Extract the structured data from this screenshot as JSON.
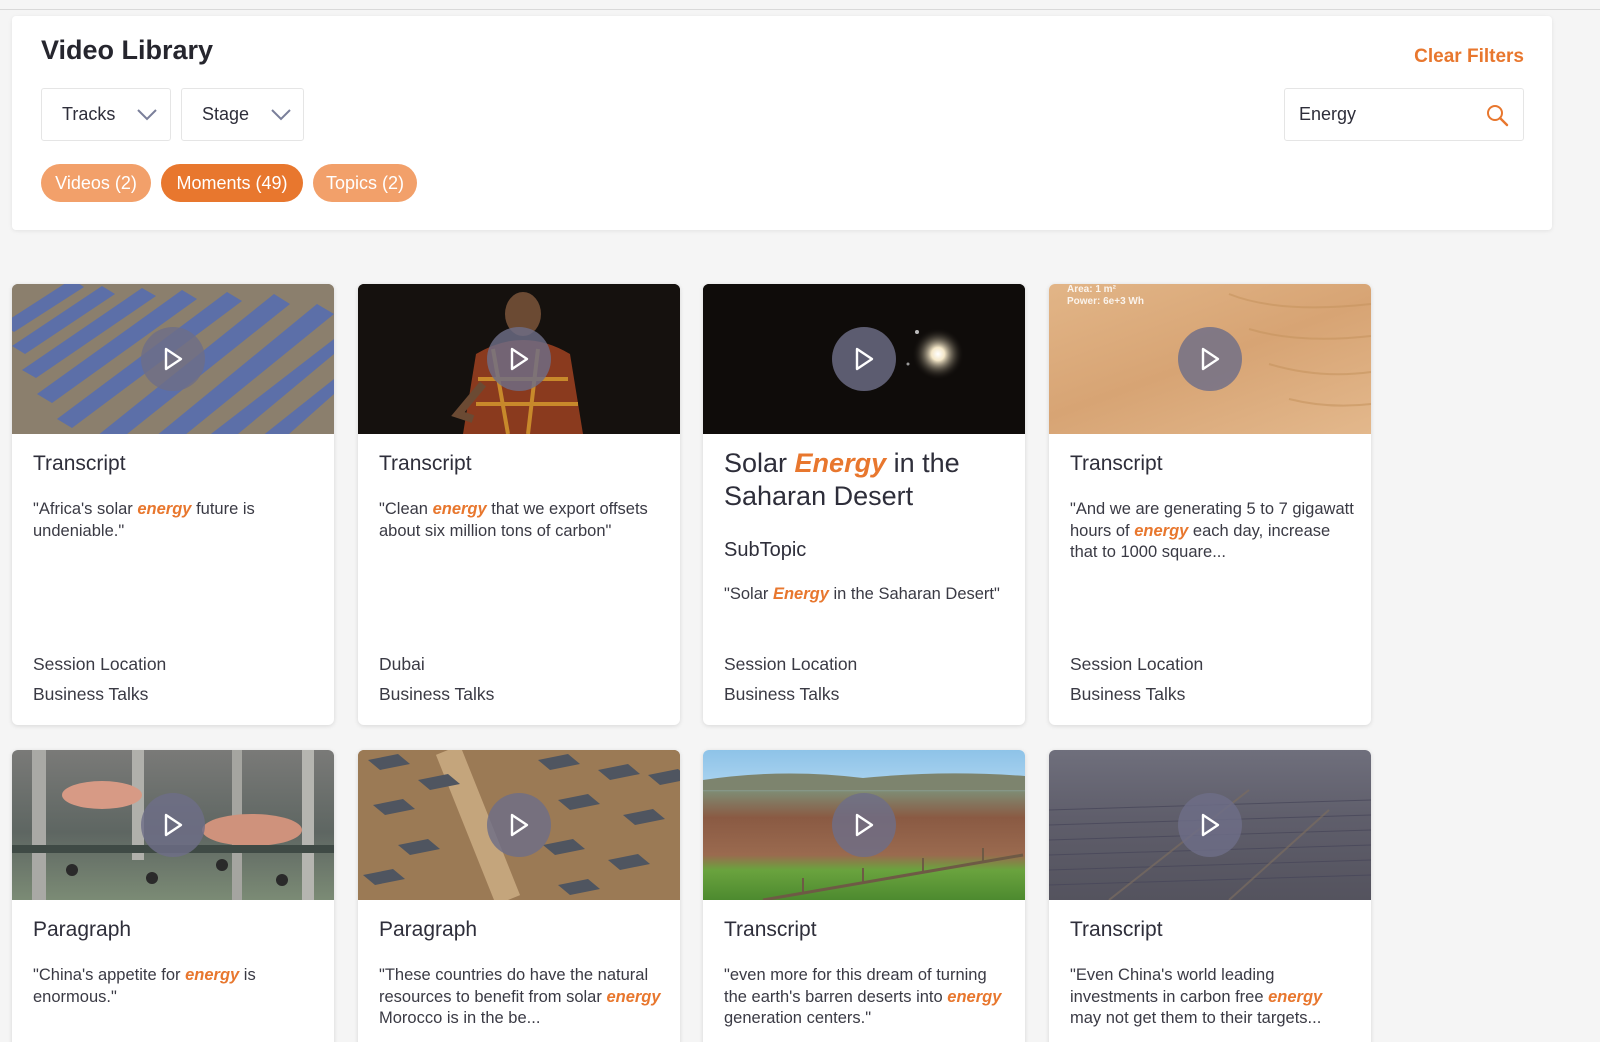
{
  "header": {
    "title": "Video Library",
    "clear_filters": "Clear Filters"
  },
  "filters": {
    "tracks_label": "Tracks",
    "stage_label": "Stage",
    "search_value": "Energy"
  },
  "pills": {
    "videos": "Videos (2)",
    "moments": "Moments (49)",
    "topics": "Topics (2)"
  },
  "cards": [
    {
      "type": "Transcript",
      "quote_before": "\"Africa's solar ",
      "quote_highlight": "energy",
      "quote_after": " future is undeniable.\"",
      "meta1": "Session Location",
      "meta2": "Business Talks"
    },
    {
      "type": "Transcript",
      "quote_before": "\"Clean ",
      "quote_highlight": "energy",
      "quote_after": " that we export offsets about six million tons of carbon\"",
      "meta1": "Dubai",
      "meta2": "Business Talks"
    },
    {
      "title_before": "Solar ",
      "title_highlight": "Energy",
      "title_after": " in the Saharan Desert",
      "subtopic": "SubTopic",
      "quote_before": "\"Solar ",
      "quote_highlight": "Energy",
      "quote_after": " in the Saharan Desert\"",
      "meta1": "Session Location",
      "meta2": "Business Talks"
    },
    {
      "type": "Transcript",
      "thumb_caption_1": "Area: 1 m²",
      "thumb_caption_2": "Power: 6e+3 Wh",
      "quote_before": "\"And we are generating 5 to 7 gigawatt hours of ",
      "quote_highlight": "energy",
      "quote_after": " each day, increase that to 1000 square...",
      "meta1": "Session Location",
      "meta2": "Business Talks"
    },
    {
      "type": "Paragraph",
      "quote_before": "\"China's appetite for ",
      "quote_highlight": "energy",
      "quote_after": " is enormous.\""
    },
    {
      "type": "Paragraph",
      "quote_before": "\"These countries do have the natural resources to benefit from solar ",
      "quote_highlight": "energy",
      "quote_after": " Morocco is in the be..."
    },
    {
      "type": "Transcript",
      "quote_before": "\"even more for this dream of turning the earth's barren deserts into ",
      "quote_highlight": "energy",
      "quote_after": " generation centers.\""
    },
    {
      "type": "Transcript",
      "quote_before": "\"Even China's world leading investments in carbon free ",
      "quote_highlight": "energy",
      "quote_after": " may not get them to their targets..."
    }
  ],
  "colors": {
    "accent": "#e8772e",
    "accent_light": "#f2a06a",
    "play_button": "#6e6e87"
  },
  "icons": {
    "dropdown": "chevron-down-icon",
    "search": "search-icon",
    "play": "play-icon"
  }
}
